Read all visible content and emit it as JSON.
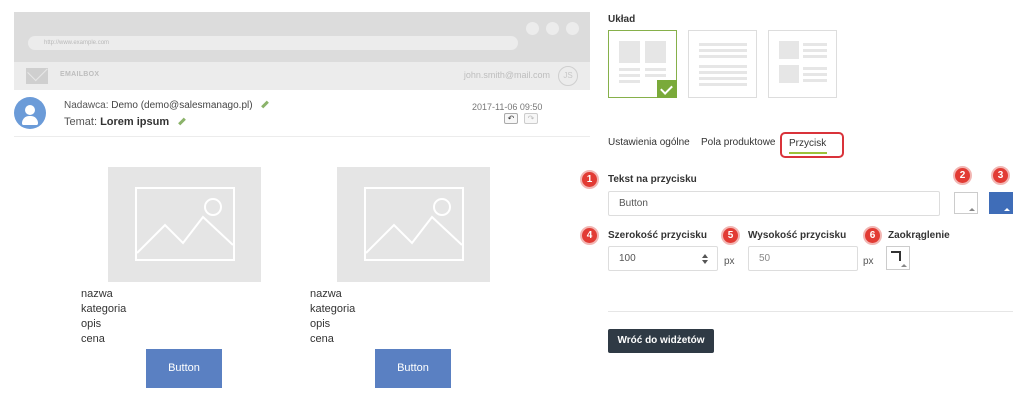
{
  "browser": {
    "address": "http://www.example.com",
    "mailbox_label": "EMAILBOX",
    "user_email": "john.smith@mail.com",
    "user_initials": "JS"
  },
  "message": {
    "sender_label": "Nadawca:",
    "sender_value": "Demo (demo@salesmanago.pl)",
    "subject_label": "Temat:",
    "subject_value": "Lorem ipsum",
    "date": "2017-11-06 09:50",
    "undo_icon": "↶",
    "redo_icon": "↷"
  },
  "products": [
    {
      "name": "nazwa",
      "category": "kategoria",
      "description": "opis",
      "price": "cena",
      "button": "Button"
    },
    {
      "name": "nazwa",
      "category": "kategoria",
      "description": "opis",
      "price": "cena",
      "button": "Button"
    }
  ],
  "panel": {
    "layout_title": "Układ",
    "tabs": [
      "Ustawienia ogólne",
      "Pola produktowe",
      "Przycisk"
    ],
    "fields": {
      "button_text_label": "Tekst na przycisku",
      "button_text_value": "Button",
      "width_label": "Szerokość przycisku",
      "width_value": "100",
      "height_label": "Wysokość przycisku",
      "height_value": "50",
      "rounding_label": "Zaokrąglenie",
      "unit": "px"
    },
    "badges": [
      "1",
      "2",
      "3",
      "4",
      "5",
      "6"
    ],
    "swatch_colors": {
      "text_color": "#ffffff",
      "button_color": "#3f6db8"
    },
    "back_button": "Wróć do widżetów"
  },
  "colors": {
    "accent_green": "#7aaa3a",
    "highlight_red": "#d9333a",
    "product_button": "#5a80c2",
    "dark_button": "#2f3a45"
  }
}
